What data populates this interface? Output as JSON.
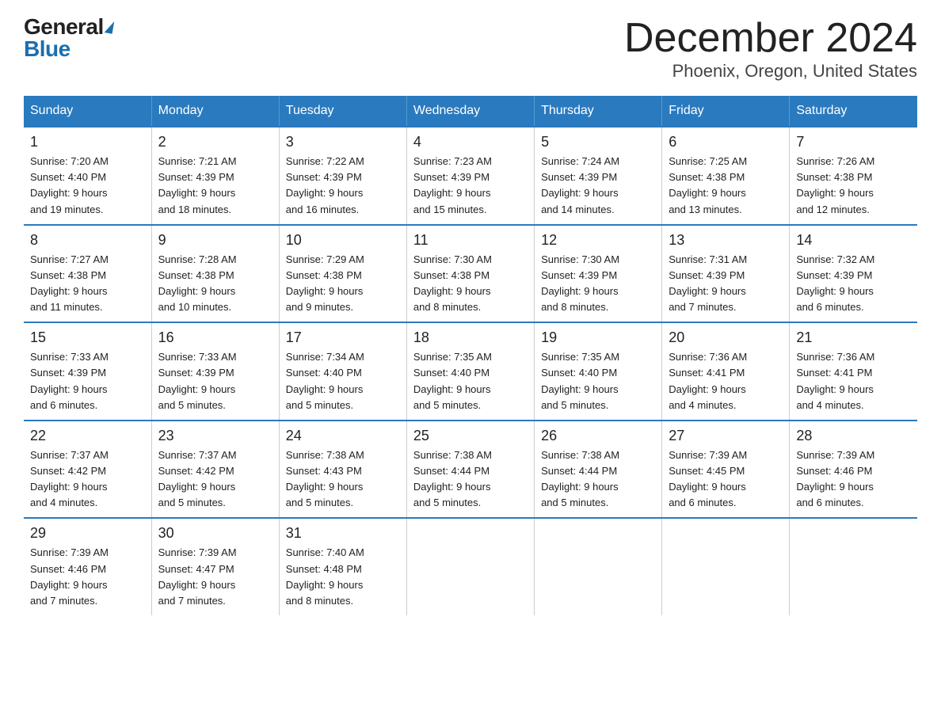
{
  "logo": {
    "general": "General",
    "blue": "Blue"
  },
  "title": "December 2024",
  "subtitle": "Phoenix, Oregon, United States",
  "days_of_week": [
    "Sunday",
    "Monday",
    "Tuesday",
    "Wednesday",
    "Thursday",
    "Friday",
    "Saturday"
  ],
  "weeks": [
    [
      {
        "day": "1",
        "sunrise": "7:20 AM",
        "sunset": "4:40 PM",
        "daylight": "9 hours and 19 minutes."
      },
      {
        "day": "2",
        "sunrise": "7:21 AM",
        "sunset": "4:39 PM",
        "daylight": "9 hours and 18 minutes."
      },
      {
        "day": "3",
        "sunrise": "7:22 AM",
        "sunset": "4:39 PM",
        "daylight": "9 hours and 16 minutes."
      },
      {
        "day": "4",
        "sunrise": "7:23 AM",
        "sunset": "4:39 PM",
        "daylight": "9 hours and 15 minutes."
      },
      {
        "day": "5",
        "sunrise": "7:24 AM",
        "sunset": "4:39 PM",
        "daylight": "9 hours and 14 minutes."
      },
      {
        "day": "6",
        "sunrise": "7:25 AM",
        "sunset": "4:38 PM",
        "daylight": "9 hours and 13 minutes."
      },
      {
        "day": "7",
        "sunrise": "7:26 AM",
        "sunset": "4:38 PM",
        "daylight": "9 hours and 12 minutes."
      }
    ],
    [
      {
        "day": "8",
        "sunrise": "7:27 AM",
        "sunset": "4:38 PM",
        "daylight": "9 hours and 11 minutes."
      },
      {
        "day": "9",
        "sunrise": "7:28 AM",
        "sunset": "4:38 PM",
        "daylight": "9 hours and 10 minutes."
      },
      {
        "day": "10",
        "sunrise": "7:29 AM",
        "sunset": "4:38 PM",
        "daylight": "9 hours and 9 minutes."
      },
      {
        "day": "11",
        "sunrise": "7:30 AM",
        "sunset": "4:38 PM",
        "daylight": "9 hours and 8 minutes."
      },
      {
        "day": "12",
        "sunrise": "7:30 AM",
        "sunset": "4:39 PM",
        "daylight": "9 hours and 8 minutes."
      },
      {
        "day": "13",
        "sunrise": "7:31 AM",
        "sunset": "4:39 PM",
        "daylight": "9 hours and 7 minutes."
      },
      {
        "day": "14",
        "sunrise": "7:32 AM",
        "sunset": "4:39 PM",
        "daylight": "9 hours and 6 minutes."
      }
    ],
    [
      {
        "day": "15",
        "sunrise": "7:33 AM",
        "sunset": "4:39 PM",
        "daylight": "9 hours and 6 minutes."
      },
      {
        "day": "16",
        "sunrise": "7:33 AM",
        "sunset": "4:39 PM",
        "daylight": "9 hours and 5 minutes."
      },
      {
        "day": "17",
        "sunrise": "7:34 AM",
        "sunset": "4:40 PM",
        "daylight": "9 hours and 5 minutes."
      },
      {
        "day": "18",
        "sunrise": "7:35 AM",
        "sunset": "4:40 PM",
        "daylight": "9 hours and 5 minutes."
      },
      {
        "day": "19",
        "sunrise": "7:35 AM",
        "sunset": "4:40 PM",
        "daylight": "9 hours and 5 minutes."
      },
      {
        "day": "20",
        "sunrise": "7:36 AM",
        "sunset": "4:41 PM",
        "daylight": "9 hours and 4 minutes."
      },
      {
        "day": "21",
        "sunrise": "7:36 AM",
        "sunset": "4:41 PM",
        "daylight": "9 hours and 4 minutes."
      }
    ],
    [
      {
        "day": "22",
        "sunrise": "7:37 AM",
        "sunset": "4:42 PM",
        "daylight": "9 hours and 4 minutes."
      },
      {
        "day": "23",
        "sunrise": "7:37 AM",
        "sunset": "4:42 PM",
        "daylight": "9 hours and 5 minutes."
      },
      {
        "day": "24",
        "sunrise": "7:38 AM",
        "sunset": "4:43 PM",
        "daylight": "9 hours and 5 minutes."
      },
      {
        "day": "25",
        "sunrise": "7:38 AM",
        "sunset": "4:44 PM",
        "daylight": "9 hours and 5 minutes."
      },
      {
        "day": "26",
        "sunrise": "7:38 AM",
        "sunset": "4:44 PM",
        "daylight": "9 hours and 5 minutes."
      },
      {
        "day": "27",
        "sunrise": "7:39 AM",
        "sunset": "4:45 PM",
        "daylight": "9 hours and 6 minutes."
      },
      {
        "day": "28",
        "sunrise": "7:39 AM",
        "sunset": "4:46 PM",
        "daylight": "9 hours and 6 minutes."
      }
    ],
    [
      {
        "day": "29",
        "sunrise": "7:39 AM",
        "sunset": "4:46 PM",
        "daylight": "9 hours and 7 minutes."
      },
      {
        "day": "30",
        "sunrise": "7:39 AM",
        "sunset": "4:47 PM",
        "daylight": "9 hours and 7 minutes."
      },
      {
        "day": "31",
        "sunrise": "7:40 AM",
        "sunset": "4:48 PM",
        "daylight": "9 hours and 8 minutes."
      },
      null,
      null,
      null,
      null
    ]
  ],
  "labels": {
    "sunrise": "Sunrise:",
    "sunset": "Sunset:",
    "daylight": "Daylight:"
  }
}
